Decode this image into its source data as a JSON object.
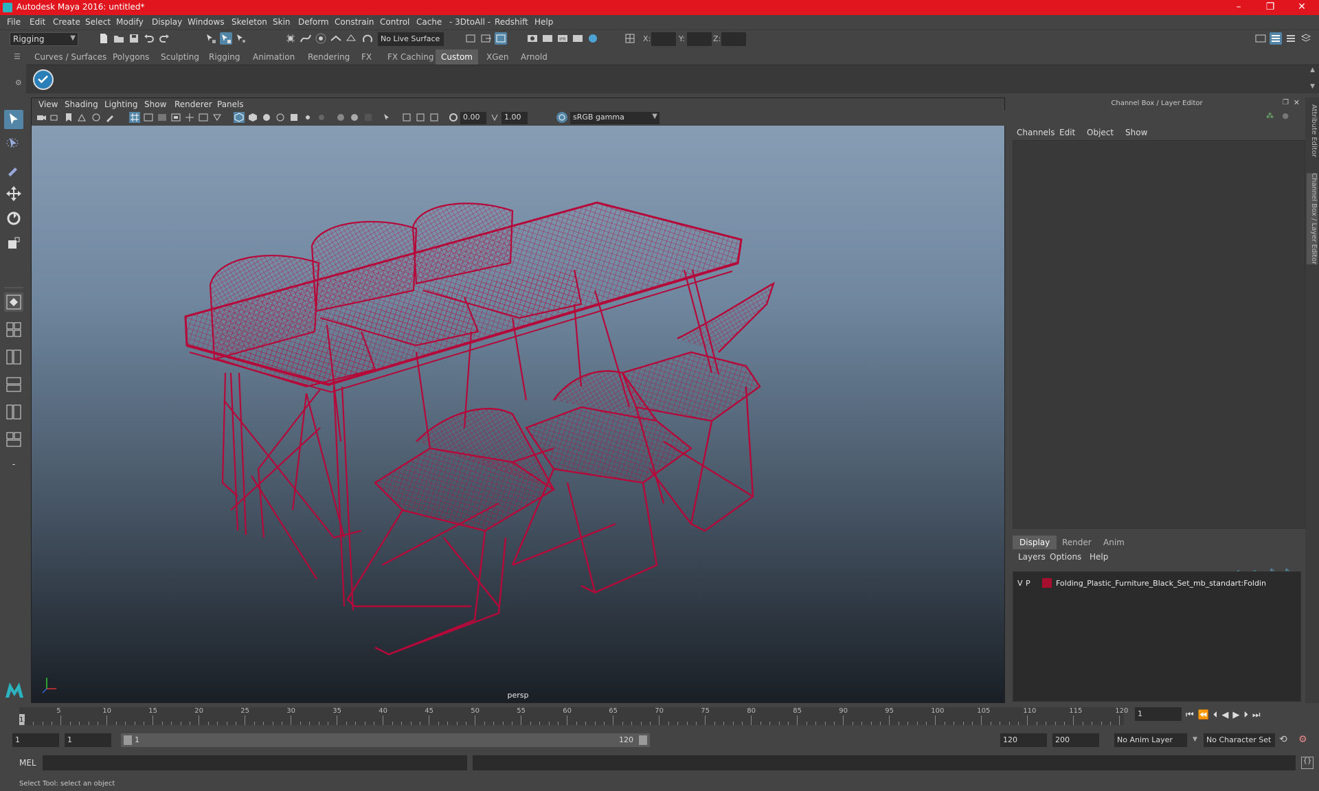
{
  "window": {
    "title": "Autodesk Maya 2016: untitled*",
    "min": "–",
    "max": "❐",
    "close": "✕"
  },
  "menubar": [
    "File",
    "Edit",
    "Create",
    "Select",
    "Modify",
    "Display",
    "Windows",
    "Skeleton",
    "Skin",
    "Deform",
    "Constrain",
    "Control",
    "Cache",
    "- 3DtoAll -",
    "Redshift",
    "Help"
  ],
  "statusline": {
    "mode": "Rigging",
    "live_surface": "No Live Surface",
    "x_label": "X:",
    "y_label": "Y:",
    "z_label": "Z:"
  },
  "shelf_tabs": [
    {
      "label": "Curves / Surfaces",
      "active": false
    },
    {
      "label": "Polygons",
      "active": false
    },
    {
      "label": "Sculpting",
      "active": false
    },
    {
      "label": "Rigging",
      "active": false
    },
    {
      "label": "Animation",
      "active": false
    },
    {
      "label": "Rendering",
      "active": false
    },
    {
      "label": "FX",
      "active": false
    },
    {
      "label": "FX Caching",
      "active": false
    },
    {
      "label": "Custom",
      "active": true
    },
    {
      "label": "XGen",
      "active": false
    },
    {
      "label": "Arnold",
      "active": false
    }
  ],
  "panel_menus": [
    "View",
    "Shading",
    "Lighting",
    "Show",
    "Renderer",
    "Panels"
  ],
  "viewport": {
    "exposure": "0.00",
    "gamma": "1.00",
    "color_space": "sRGB gamma",
    "camera": "persp",
    "wire_color": "#b5093a"
  },
  "channel_box": {
    "header": "Channel Box / Layer Editor",
    "menus": [
      "Channels",
      "Edit",
      "Object",
      "Show"
    ]
  },
  "layer_editor": {
    "tabs": [
      {
        "label": "Display",
        "active": true
      },
      {
        "label": "Render",
        "active": false
      },
      {
        "label": "Anim",
        "active": false
      }
    ],
    "menus": [
      "Layers",
      "Options",
      "Help"
    ],
    "layer": {
      "v": "V",
      "p": "P",
      "name": "Folding_Plastic_Furniture_Black_Set_mb_standart:Foldin",
      "color": "#a6102e"
    }
  },
  "side_tabs": [
    "Attribute Editor",
    "Channel Box / Layer Editor"
  ],
  "timeline": {
    "ticks": [
      "5",
      "10",
      "15",
      "20",
      "25",
      "30",
      "35",
      "40",
      "45",
      "50",
      "55",
      "60",
      "65",
      "70",
      "75",
      "80",
      "85",
      "90",
      "95",
      "100",
      "105",
      "110",
      "115",
      "120"
    ],
    "current_frame_marker": "1",
    "current_frame": "1"
  },
  "range": {
    "start": "1",
    "playback_start": "1",
    "slider_start": "1",
    "slider_end": "120",
    "playback_end": "120",
    "end": "200",
    "anim_layer": "No Anim Layer",
    "character_set": "No Character Set"
  },
  "cmdline": {
    "label": "MEL"
  },
  "helpline": {
    "text": "Select Tool: select an object"
  }
}
